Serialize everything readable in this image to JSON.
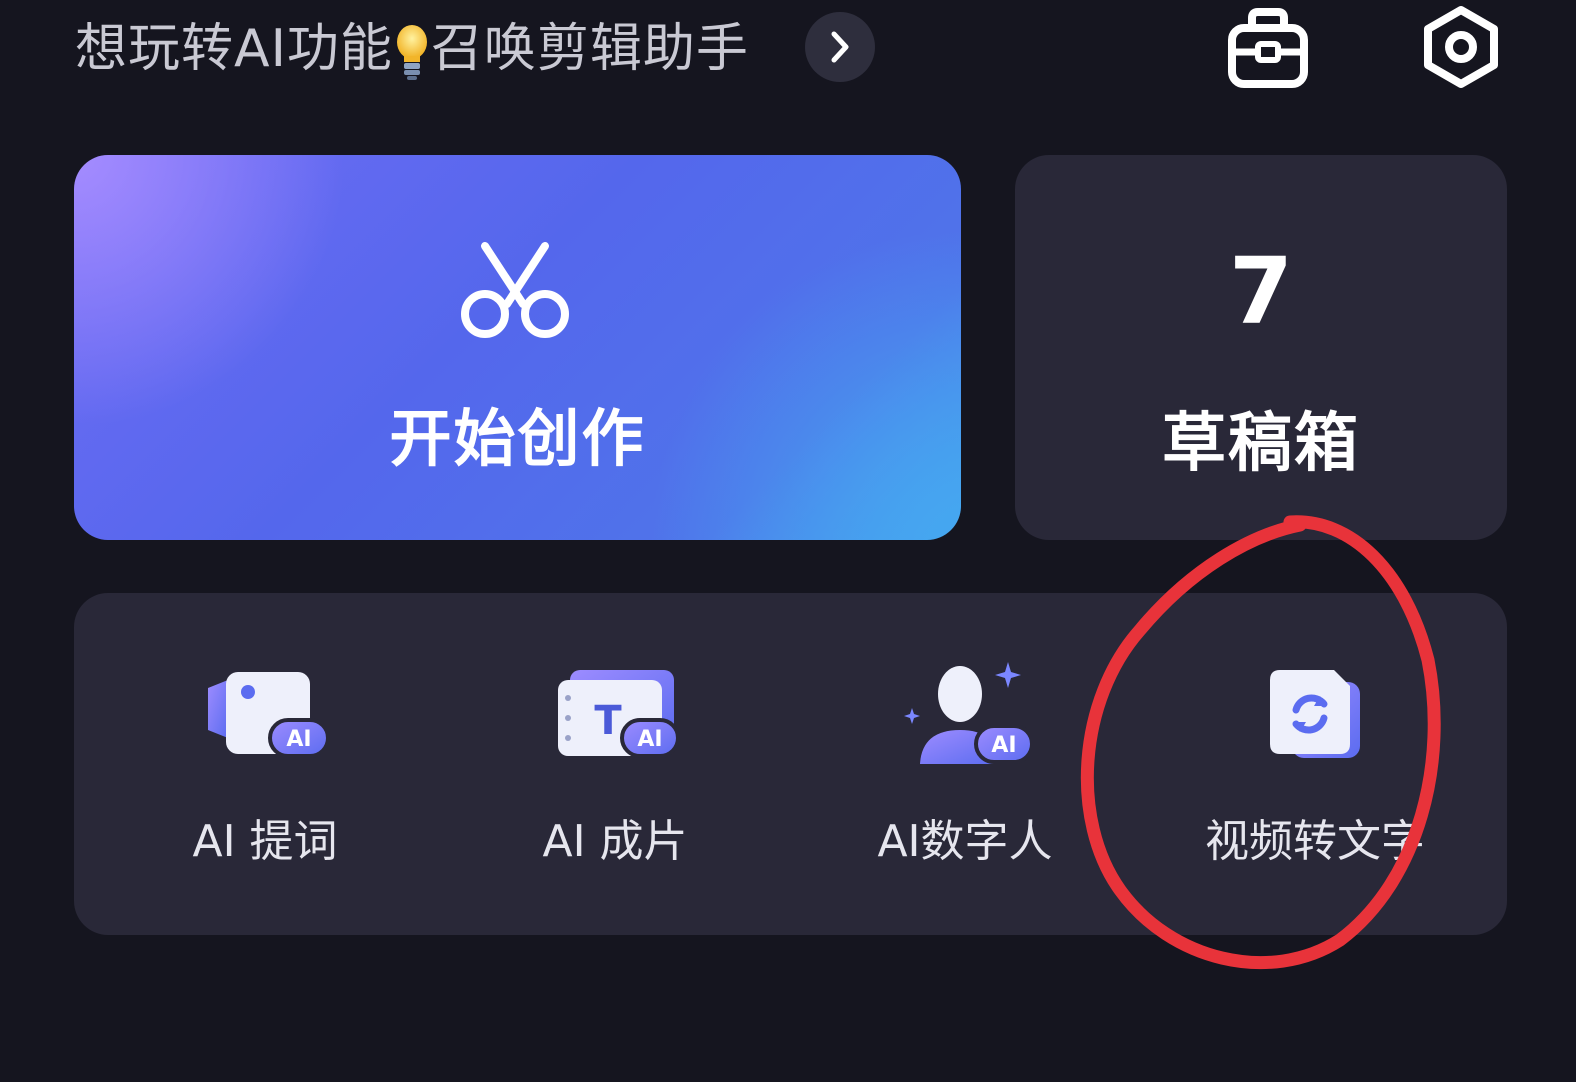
{
  "header": {
    "promo_prefix": "想玩转AI功能",
    "promo_suffix": "召唤剪辑助手",
    "promo_icon": "lightbulb-icon",
    "arrow_icon": "chevron-right-icon",
    "right_icons": [
      "briefcase-icon",
      "settings-hexagon-icon"
    ]
  },
  "create": {
    "label": "开始创作",
    "icon": "scissors-icon"
  },
  "drafts": {
    "count": "7",
    "label": "草稿箱"
  },
  "tools": [
    {
      "label": "AI 提词",
      "icon": "ai-teleprompter-icon"
    },
    {
      "label": "AI 成片",
      "icon": "ai-film-icon"
    },
    {
      "label": "AI数字人",
      "icon": "ai-avatar-icon"
    },
    {
      "label": "视频转文字",
      "icon": "video-to-text-icon"
    }
  ],
  "colors": {
    "background": "#15151f",
    "card": "#292838",
    "accent_gradient_start": "#8b7cf8",
    "accent_gradient_end": "#47a0ee",
    "annotation": "#e8333a"
  }
}
